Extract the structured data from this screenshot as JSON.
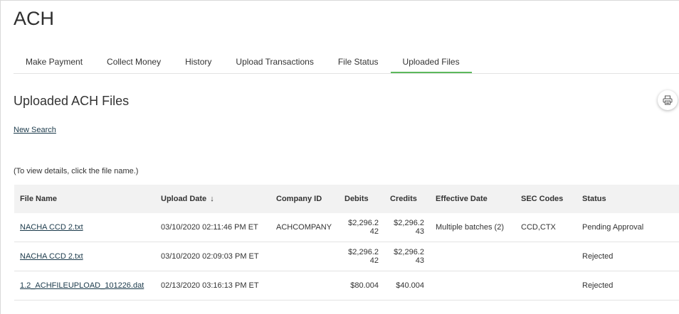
{
  "app": {
    "title": "ACH"
  },
  "tabs": [
    {
      "label": "Make Payment",
      "active": false
    },
    {
      "label": "Collect Money",
      "active": false
    },
    {
      "label": "History",
      "active": false
    },
    {
      "label": "Upload Transactions",
      "active": false
    },
    {
      "label": "File Status",
      "active": false
    },
    {
      "label": "Uploaded Files",
      "active": true
    }
  ],
  "page": {
    "title": "Uploaded ACH Files",
    "print_icon": "printer-icon",
    "new_search_label": "New Search",
    "instructions": "(To view details, click the file name.)"
  },
  "table": {
    "headers": {
      "file_name": "File Name",
      "upload_date": "Upload Date",
      "company_id": "Company ID",
      "debits": "Debits",
      "credits": "Credits",
      "effective_date": "Effective Date",
      "sec_codes": "SEC Codes",
      "status": "Status"
    },
    "sort": {
      "column": "upload_date",
      "direction": "descending",
      "indicator": "↓"
    },
    "rows": [
      {
        "file_name": "NACHA CCD 2.txt",
        "upload_date": "03/10/2020 02:11:46 PM ET",
        "company_id": "ACHCOMPANY",
        "debits": "$2,296.242",
        "credits": "$2,296.243",
        "effective_date": "Multiple batches (2)",
        "sec_codes": "CCD,CTX",
        "status": "Pending Approval"
      },
      {
        "file_name": "NACHA CCD 2.txt",
        "upload_date": "03/10/2020 02:09:03 PM ET",
        "company_id": "",
        "debits": "$2,296.242",
        "credits": "$2,296.243",
        "effective_date": "",
        "sec_codes": "",
        "status": "Rejected"
      },
      {
        "file_name": "1.2_ACHFILEUPLOAD_101226.dat",
        "upload_date": "02/13/2020 03:16:13 PM ET",
        "company_id": "",
        "debits": "$80.004",
        "credits": "$40.004",
        "effective_date": "",
        "sec_codes": "",
        "status": "Rejected"
      }
    ]
  },
  "colors": {
    "active_tab_underline": "#5cb85c",
    "link": "#1b3a4b",
    "header_bg": "#f2f2f2"
  }
}
